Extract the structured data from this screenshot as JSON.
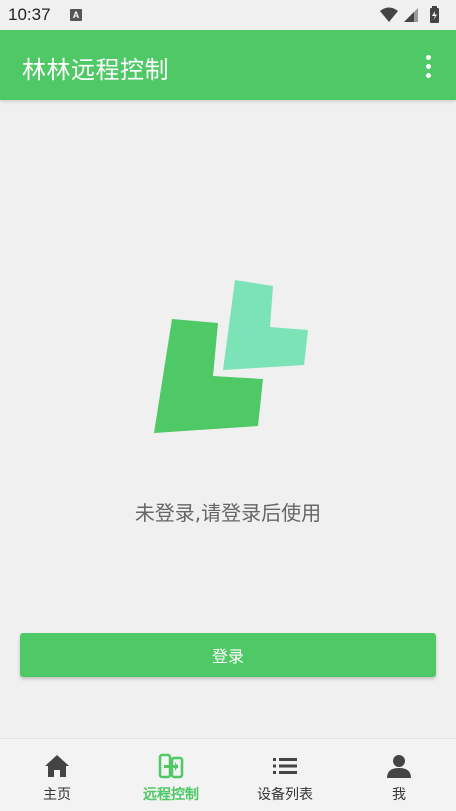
{
  "status_bar": {
    "time": "10:37",
    "notification_letter": "A"
  },
  "app_bar": {
    "title": "林林远程控制",
    "menu_icon": "more-vert-icon"
  },
  "main": {
    "logo_icon": "app-logo",
    "message": "未登录,请登录后使用",
    "login_label": "登录"
  },
  "bottom_nav": {
    "active_color": "#4fc866",
    "items": [
      {
        "label": "主页",
        "icon": "home-icon"
      },
      {
        "label": "远程控制",
        "icon": "remote-control-icon",
        "active": true
      },
      {
        "label": "设备列表",
        "icon": "list-icon"
      },
      {
        "label": "我",
        "icon": "person-icon"
      }
    ]
  },
  "colors": {
    "primary": "#4fc866",
    "logo_light": "#7be3b6",
    "background": "#f0f0f0"
  }
}
